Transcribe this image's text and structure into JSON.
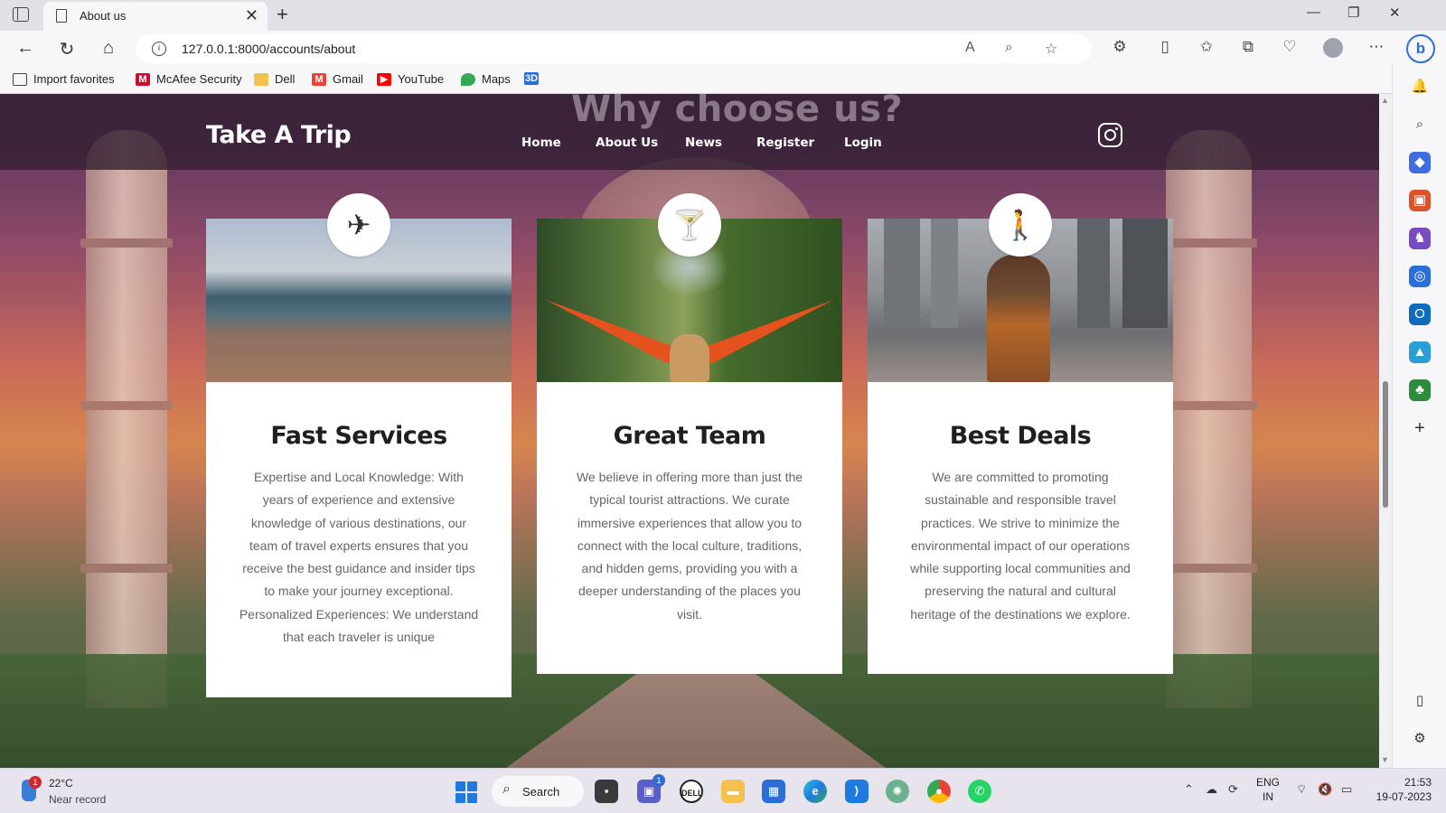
{
  "browser": {
    "tab_title": "About us",
    "url": "127.0.0.1:8000/accounts/about",
    "new_tab": "+",
    "close_tab": "✕",
    "favorites": [
      {
        "label": "Import favorites",
        "icon": "import-icon",
        "color": "#444444"
      },
      {
        "label": "McAfee Security",
        "icon": "mcafee-icon",
        "color": "#c8102e"
      },
      {
        "label": "Dell",
        "icon": "folder-icon",
        "color": "#f2c14e"
      },
      {
        "label": "Gmail",
        "icon": "gmail-icon",
        "color": "#ea4335"
      },
      {
        "label": "YouTube",
        "icon": "youtube-icon",
        "color": "#ff0000"
      },
      {
        "label": "Maps",
        "icon": "maps-icon",
        "color": "#34a853"
      },
      {
        "label": "3D",
        "icon": "3d-icon",
        "color": "#2b6fd6"
      }
    ]
  },
  "site": {
    "brand": "Take A Trip",
    "ghost_heading": "Why choose us?",
    "nav": [
      "Home",
      "About Us",
      "News",
      "Register",
      "Login"
    ],
    "social": "instagram-icon",
    "cards": [
      {
        "title": "Fast Services",
        "icon": "airplane-icon",
        "text": "Expertise and Local Knowledge: With years of experience and extensive knowledge of various destinations, our team of travel experts ensures that you receive the best guidance and insider tips to make your journey exceptional. Personalized Experiences: We understand that each traveler is unique"
      },
      {
        "title": "Great Team",
        "icon": "cocktail-icon",
        "text": "We believe in offering more than just the typical tourist attractions. We curate immersive experiences that allow you to connect with the local culture, traditions, and hidden gems, providing you with a deeper understanding of the places you visit."
      },
      {
        "title": "Best Deals",
        "icon": "hiker-icon",
        "text": "We are committed to promoting sustainable and responsible travel practices. We strive to minimize the environmental impact of our operations while supporting local communities and preserving the natural and cultural heritage of the destinations we explore."
      }
    ]
  },
  "taskbar": {
    "weather_temp": "22°C",
    "weather_desc": "Near record",
    "weather_badge": "1",
    "search": "Search",
    "chat_badge": "1",
    "lang_top": "ENG",
    "lang_bottom": "IN",
    "time": "21:53",
    "date": "19-07-2023"
  }
}
